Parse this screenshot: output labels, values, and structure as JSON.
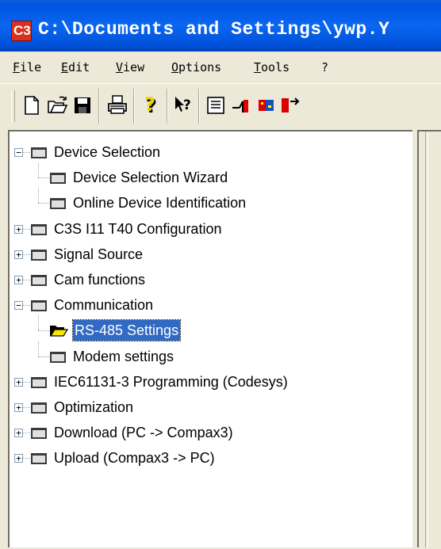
{
  "titlebar": {
    "icon_text": "C3",
    "title": "C:\\Documents and Settings\\ywp.Y"
  },
  "menubar": {
    "items": [
      "File",
      "Edit",
      "View",
      "Options",
      "Tools",
      "?"
    ]
  },
  "toolbar": {
    "buttons": [
      "new-document-icon",
      "open-folder-icon",
      "save-icon",
      "print-icon",
      "help-icon",
      "context-help-icon",
      "properties-icon",
      "signal-icon",
      "device-icon",
      "transfer-icon"
    ]
  },
  "tree": {
    "nodes": [
      {
        "label": "Device Selection",
        "level": 0,
        "expander": "minus"
      },
      {
        "label": "Device Selection Wizard",
        "level": 1,
        "expander": "none"
      },
      {
        "label": "Online Device Identification",
        "level": 1,
        "expander": "none"
      },
      {
        "label": "C3S I11 T40 Configuration",
        "level": 0,
        "expander": "plus"
      },
      {
        "label": "Signal Source",
        "level": 0,
        "expander": "plus"
      },
      {
        "label": "Cam functions",
        "level": 0,
        "expander": "plus"
      },
      {
        "label": "Communication",
        "level": 0,
        "expander": "minus"
      },
      {
        "label": "RS-485 Settings",
        "level": 1,
        "expander": "none",
        "selected": true,
        "open": true
      },
      {
        "label": "Modem settings",
        "level": 1,
        "expander": "none"
      },
      {
        "label": "IEC61131-3 Programming (Codesys)",
        "level": 0,
        "expander": "plus"
      },
      {
        "label": "Optimization",
        "level": 0,
        "expander": "plus"
      },
      {
        "label": "Download (PC -> Compax3)",
        "level": 0,
        "expander": "plus"
      },
      {
        "label": "Upload (Compax3 -> PC)",
        "level": 0,
        "expander": "plus"
      }
    ]
  },
  "colors": {
    "titlebar": "#0054e3",
    "selection": "#316ac5",
    "window_bg": "#ece9d8"
  }
}
